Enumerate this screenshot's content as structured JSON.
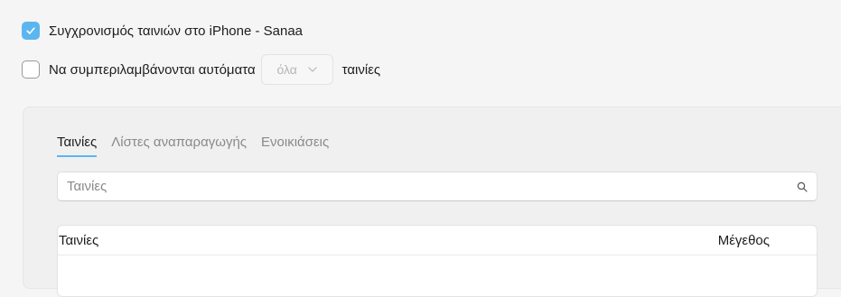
{
  "sync": {
    "label": "Συγχρονισμός ταινιών στο iPhone - Sanaa",
    "checked": true
  },
  "auto_include": {
    "label_before": "Να συμπεριλαμβάνονται αυτόματα",
    "select_value": "όλα",
    "label_after": "ταινίες",
    "checked": false
  },
  "tabs": [
    {
      "label": "Ταινίες",
      "active": true
    },
    {
      "label": "Λίστες αναπαραγωγής",
      "active": false
    },
    {
      "label": "Ενοικιάσεις",
      "active": false
    }
  ],
  "search": {
    "placeholder": "Ταινίες"
  },
  "table": {
    "columns": [
      "Ταινίες",
      "Μέγεθος"
    ]
  },
  "colors": {
    "accent": "#5bb6f0"
  }
}
